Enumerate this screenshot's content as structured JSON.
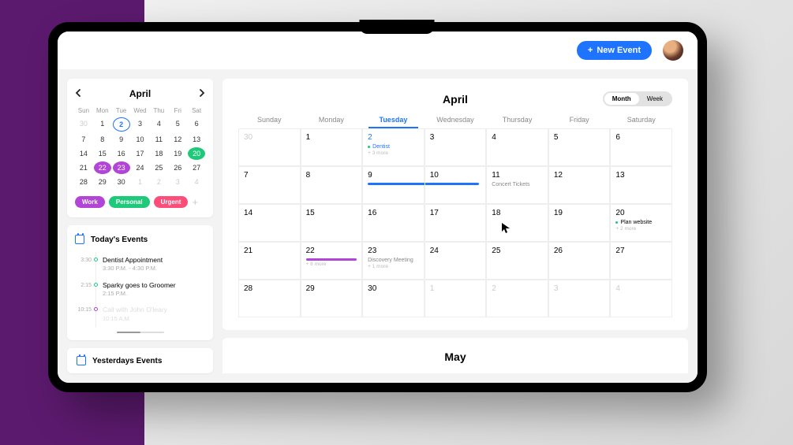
{
  "topbar": {
    "new_event_label": "New Event"
  },
  "minical": {
    "title": "April",
    "dow": [
      "Sun",
      "Mon",
      "Tue",
      "Wed",
      "Thu",
      "Fri",
      "Sat"
    ],
    "rows": [
      [
        {
          "n": "30",
          "dim": true
        },
        {
          "n": "1"
        },
        {
          "n": "2",
          "today": true
        },
        {
          "n": "3"
        },
        {
          "n": "4"
        },
        {
          "n": "5"
        },
        {
          "n": "6"
        }
      ],
      [
        {
          "n": "7"
        },
        {
          "n": "8"
        },
        {
          "n": "9"
        },
        {
          "n": "10"
        },
        {
          "n": "11"
        },
        {
          "n": "12"
        },
        {
          "n": "13"
        }
      ],
      [
        {
          "n": "14"
        },
        {
          "n": "15"
        },
        {
          "n": "16"
        },
        {
          "n": "17"
        },
        {
          "n": "18"
        },
        {
          "n": "19"
        },
        {
          "n": "20",
          "green": true
        }
      ],
      [
        {
          "n": "21"
        },
        {
          "n": "22",
          "sel": true
        },
        {
          "n": "23",
          "sel": true
        },
        {
          "n": "24"
        },
        {
          "n": "25"
        },
        {
          "n": "26"
        },
        {
          "n": "27"
        }
      ],
      [
        {
          "n": "28"
        },
        {
          "n": "29"
        },
        {
          "n": "30"
        },
        {
          "n": "1",
          "dim": true
        },
        {
          "n": "2",
          "dim": true
        },
        {
          "n": "3",
          "dim": true
        },
        {
          "n": "4",
          "dim": true
        }
      ]
    ],
    "tags": {
      "work": "Work",
      "personal": "Personal",
      "urgent": "Urgent"
    }
  },
  "today": {
    "title": "Today's Events",
    "items": [
      {
        "time": "3:30",
        "dot": "green",
        "title": "Dentist Appointment",
        "sub": "3:30 P.M. - 4:30 P.M."
      },
      {
        "time": "2:15",
        "dot": "green",
        "title": "Sparky goes to Groomer",
        "sub": "2:15 P.M."
      },
      {
        "time": "10:15",
        "dot": "purple",
        "title": "Call with John O'leary",
        "sub": "10:15 A.M.",
        "fade": true
      }
    ]
  },
  "yesterday": {
    "title": "Yesterdays Events"
  },
  "maincal": {
    "title": "April",
    "view": {
      "month": "Month",
      "week": "Week",
      "active": "month"
    },
    "dow": [
      "Sunday",
      "Monday",
      "Tuesday",
      "Wednesday",
      "Thursday",
      "Friday",
      "Saturday"
    ],
    "dow_selected": 2,
    "cells": [
      [
        {
          "n": "30",
          "dim": true
        },
        {
          "n": "1"
        },
        {
          "n": "2",
          "today": true,
          "evt": {
            "dot": "green",
            "label": "Dentist"
          },
          "more": "+ 3 more"
        },
        {
          "n": "3"
        },
        {
          "n": "4"
        },
        {
          "n": "5"
        },
        {
          "n": "6"
        }
      ],
      [
        {
          "n": "7"
        },
        {
          "n": "8"
        },
        {
          "n": "9",
          "bar": "blue",
          "barspan": 2
        },
        {
          "n": "10"
        },
        {
          "n": "11",
          "note": "Concert Tickets"
        },
        {
          "n": "12"
        },
        {
          "n": "13"
        }
      ],
      [
        {
          "n": "14"
        },
        {
          "n": "15"
        },
        {
          "n": "16"
        },
        {
          "n": "17"
        },
        {
          "n": "18",
          "cursor": true
        },
        {
          "n": "19"
        },
        {
          "n": "20",
          "evt": {
            "dot": "green",
            "label": "Plan website"
          },
          "more": "+ 2 more"
        }
      ],
      [
        {
          "n": "21"
        },
        {
          "n": "22",
          "bar": "purple",
          "more": "+ 8 more"
        },
        {
          "n": "23",
          "note": "Discovery Meeting",
          "more": "+ 1 more"
        },
        {
          "n": "24"
        },
        {
          "n": "25"
        },
        {
          "n": "26"
        },
        {
          "n": "27"
        }
      ],
      [
        {
          "n": "28"
        },
        {
          "n": "29"
        },
        {
          "n": "30"
        },
        {
          "n": "1",
          "dim": true
        },
        {
          "n": "2",
          "dim": true
        },
        {
          "n": "3",
          "dim": true
        },
        {
          "n": "4",
          "dim": true
        }
      ]
    ]
  },
  "nextcal": {
    "title": "May"
  }
}
